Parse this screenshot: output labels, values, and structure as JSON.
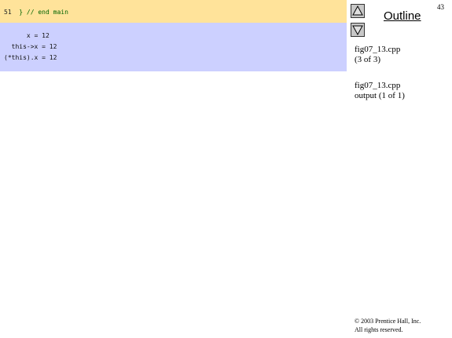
{
  "code": {
    "line_number": "51",
    "text": "} // end main"
  },
  "output": {
    "lines": [
      "      x = 12",
      "  this->x = 12",
      "(*this).x = 12"
    ]
  },
  "sidebar": {
    "title": "Outline",
    "page_number": "43",
    "links": [
      {
        "line1": "fig07_13.cpp",
        "line2": "(3 of 3)"
      },
      {
        "line1": "fig07_13.cpp",
        "line2": "output (1 of 1)"
      }
    ],
    "nav_up_icon": "triangle-up-icon",
    "nav_down_icon": "triangle-down-icon"
  },
  "footer": {
    "line1": "© 2003 Prentice Hall, Inc.",
    "line2": "All rights reserved."
  }
}
